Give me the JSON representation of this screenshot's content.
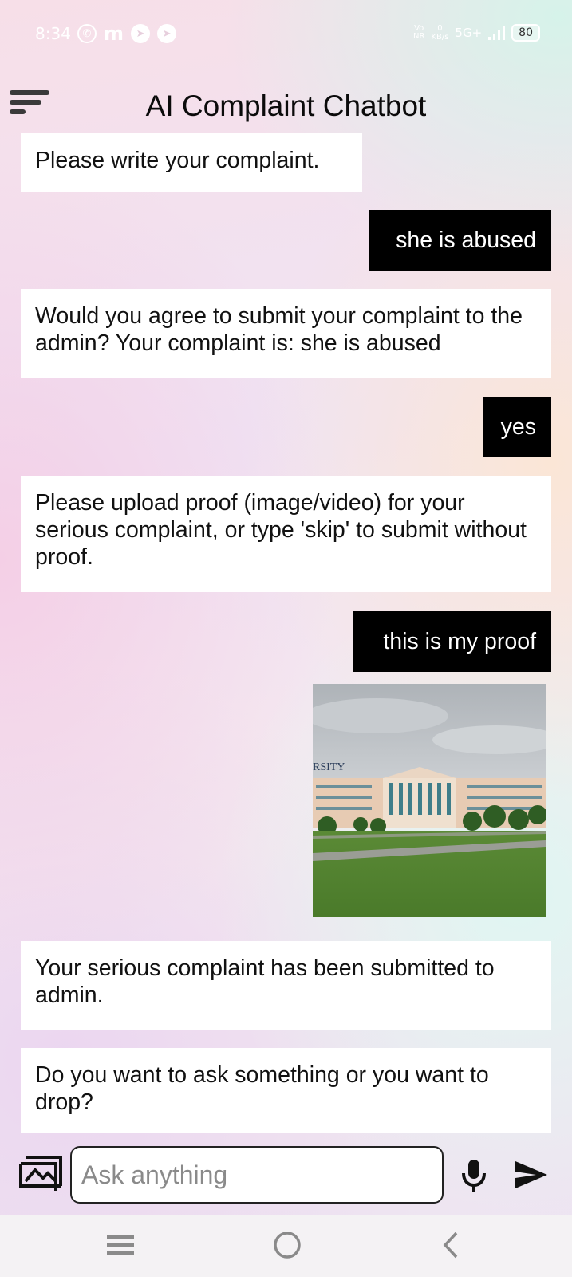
{
  "status_bar": {
    "time": "8:34",
    "network_label_top": "Vo",
    "network_label_bottom": "NR",
    "speed_value": "0",
    "speed_unit": "KB/s",
    "network_type": "5G+",
    "battery": "80"
  },
  "header": {
    "title": "AI Complaint Chatbot"
  },
  "messages": [
    {
      "sender": "bot",
      "text": "Please write your complaint."
    },
    {
      "sender": "user",
      "text": "she is abused"
    },
    {
      "sender": "bot",
      "text": "Would you agree to submit your complaint to the admin? Your complaint is: she is abused"
    },
    {
      "sender": "user",
      "text": "yes"
    },
    {
      "sender": "bot",
      "text": "Please upload proof (image/video) for your serious complaint, or type 'skip' to submit without proof."
    },
    {
      "sender": "user",
      "text": "this is my proof"
    },
    {
      "sender": "user",
      "type": "image",
      "sign_text": "RSITY"
    },
    {
      "sender": "bot",
      "text": "Your serious complaint has been submitted to admin."
    },
    {
      "sender": "bot",
      "text": "Do you want to ask something or you want to drop?"
    }
  ],
  "input": {
    "placeholder": "Ask anything",
    "value": ""
  },
  "icons": {
    "menu": "menu-icon",
    "gallery": "image-upload-icon",
    "mic": "microphone-icon",
    "send": "send-icon",
    "nav_recents": "recents-icon",
    "nav_home": "home-icon",
    "nav_back": "back-icon"
  }
}
